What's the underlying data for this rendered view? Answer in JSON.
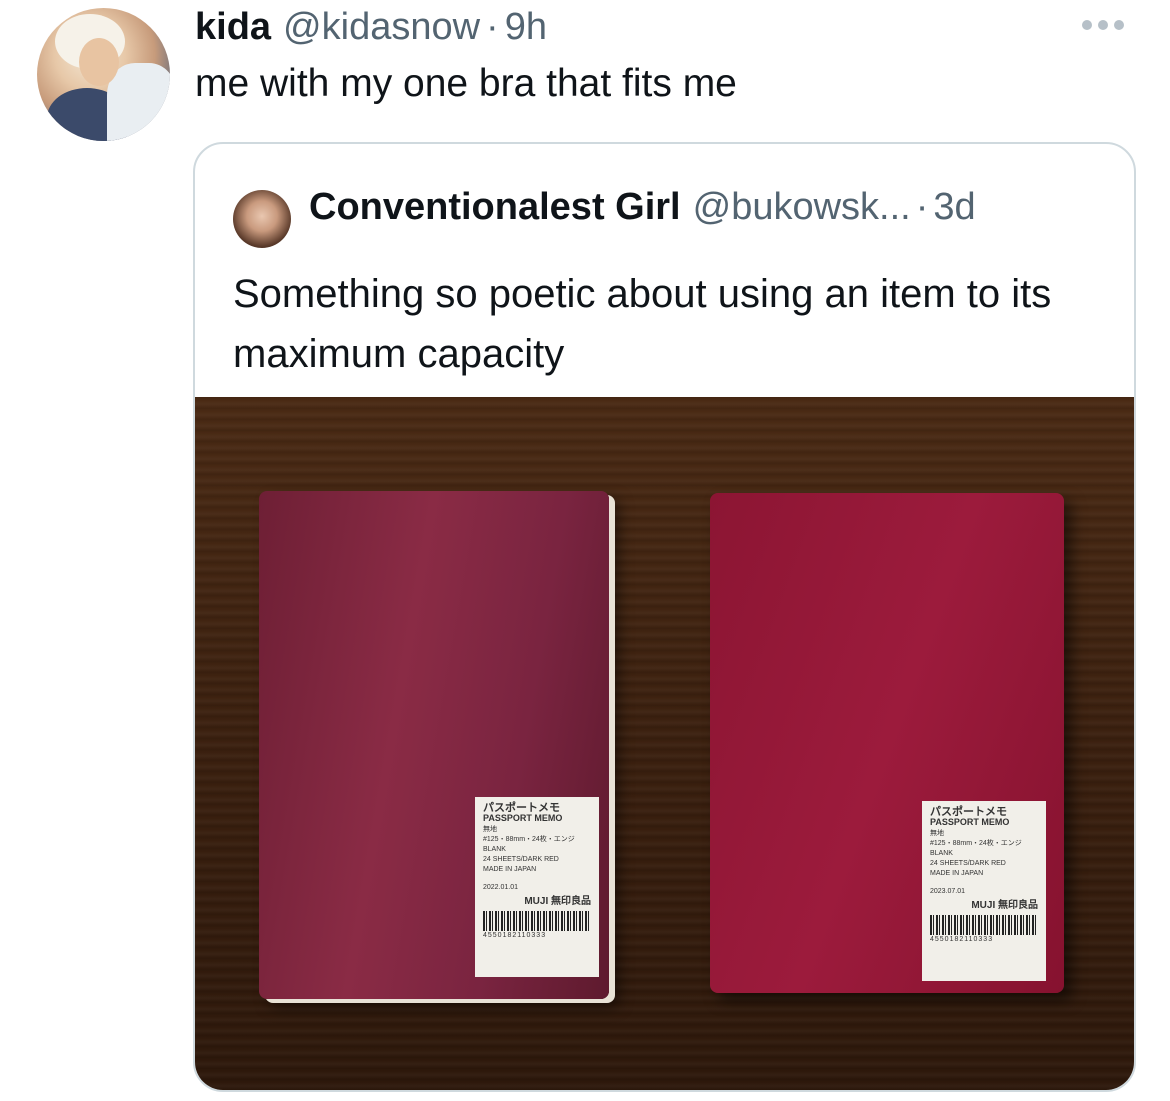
{
  "tweet": {
    "display_name": "kida",
    "handle": "@kidasnow",
    "separator": "·",
    "time": "9h",
    "text": "me with my one bra that fits me",
    "more_icon": "more-horizontal-icon"
  },
  "quoted": {
    "display_name": "Conventionalest Girl",
    "handle": "@bukowsk...",
    "separator": "·",
    "time": "3d",
    "text": "Something so poetic about using an item to its maximum capacity"
  },
  "photo": {
    "notebooks": [
      {
        "label_jp": "パスポートメモ",
        "label_en": "PASSPORT MEMO",
        "line1": "無地",
        "line2": "#125・88mm・24枚・エンジ",
        "line3": "BLANK",
        "line4": "24 SHEETS/DARK RED",
        "line5": "MADE IN JAPAN",
        "date": "2022.01.01",
        "brand": "MUJI 無印良品",
        "ean": "4550182110333"
      },
      {
        "label_jp": "パスポートメモ",
        "label_en": "PASSPORT MEMO",
        "line1": "無地",
        "line2": "#125・88mm・24枚・エンジ",
        "line3": "BLANK",
        "line4": "24 SHEETS/DARK RED",
        "line5": "MADE IN JAPAN",
        "date": "2023.07.01",
        "brand": "MUJI 無印良品",
        "ean": "4550182110333"
      }
    ]
  }
}
